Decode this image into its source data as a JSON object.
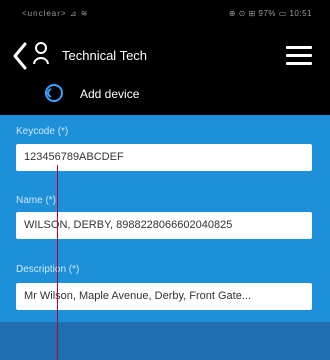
{
  "status": {
    "left": "<unclear> ⊿ ≋",
    "right": "⊕ ⊙ ⊞ 97% ▭ 10:51"
  },
  "header": {
    "title": "Technical Tech",
    "subtitle": "Add device"
  },
  "form": {
    "keycode": {
      "label": "Keycode (*)",
      "value": "123456789ABCDEF"
    },
    "name": {
      "label": "Name (*)",
      "value": "WILSON, DERBY, 8988228066602040825"
    },
    "description": {
      "label": "Description (*)",
      "value": "Mr Wilson, Maple Avenue, Derby, Front Gate..."
    }
  },
  "colors": {
    "topbar": "#000000",
    "form_bg": "#1e8fd9",
    "bottom_bar": "#1f6fb0",
    "cursor_line": "#c0002a"
  },
  "icons": {
    "back": "chevron-left-icon",
    "user": "user-icon",
    "menu": "hamburger-menu-icon",
    "add": "add-device-icon"
  }
}
